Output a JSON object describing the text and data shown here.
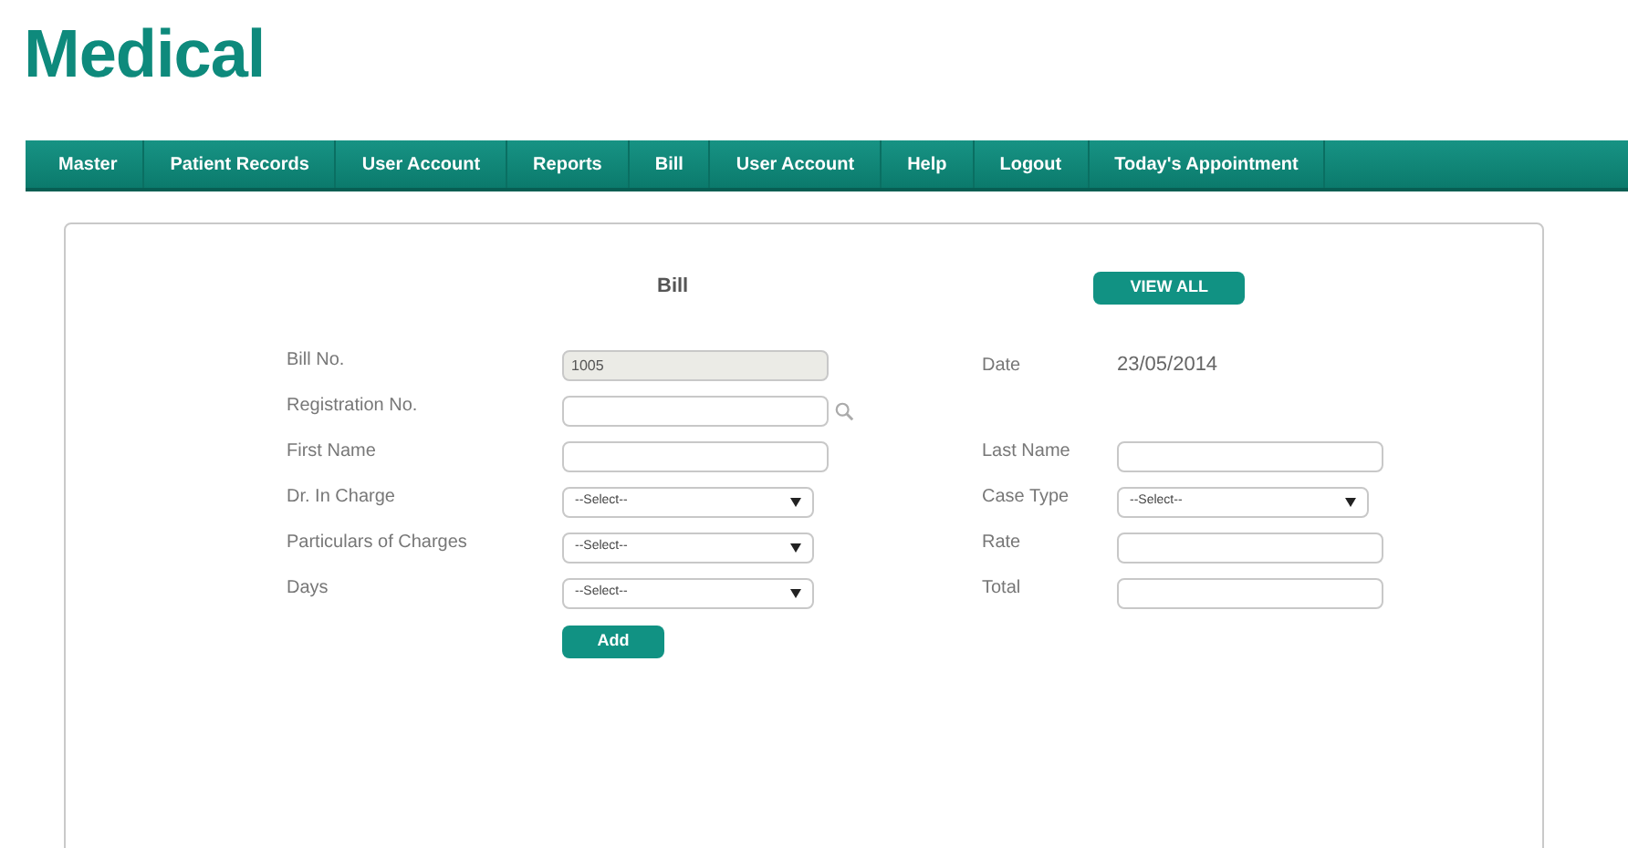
{
  "logo": "Medical",
  "nav": [
    {
      "label": "Master"
    },
    {
      "label": "Patient Records"
    },
    {
      "label": "User Account"
    },
    {
      "label": "Reports"
    },
    {
      "label": "Bill"
    },
    {
      "label": "User Account"
    },
    {
      "label": "Help"
    },
    {
      "label": "Logout"
    },
    {
      "label": "Today's Appointment"
    }
  ],
  "form": {
    "title": "Bill",
    "view_all": "VIEW ALL",
    "rows": [
      {
        "left": {
          "label": "Bill No.",
          "kind": "readonly",
          "value": "1005"
        },
        "right": {
          "label": "Date",
          "kind": "text",
          "value": "23/05/2014"
        }
      },
      {
        "left": {
          "label": "Registration No.",
          "kind": "search"
        }
      },
      {
        "left": {
          "label": "First Name",
          "kind": "input"
        },
        "right": {
          "label": "Last Name",
          "kind": "input"
        }
      },
      {
        "left": {
          "label": "Dr. In Charge",
          "kind": "select",
          "value": "--Select--"
        },
        "right": {
          "label": "Case Type",
          "kind": "select",
          "value": "--Select--"
        }
      },
      {
        "left": {
          "label": "Particulars of Charges",
          "kind": "select",
          "value": "--Select--"
        },
        "right": {
          "label": "Rate",
          "kind": "input"
        }
      },
      {
        "left": {
          "label": "Days",
          "kind": "select",
          "value": "--Select--"
        },
        "right": {
          "label": "Total",
          "kind": "input"
        }
      }
    ],
    "add": "Add"
  }
}
